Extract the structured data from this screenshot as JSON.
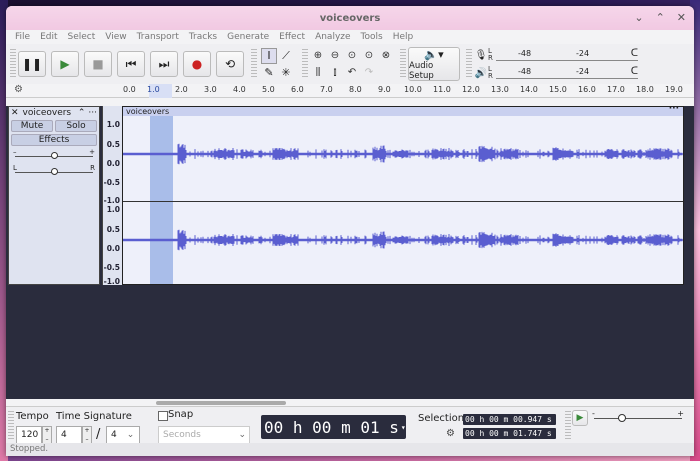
{
  "window": {
    "title": "voiceovers",
    "controls": [
      "⌄",
      "⌃",
      "✕"
    ]
  },
  "menu": [
    "File",
    "Edit",
    "Select",
    "View",
    "Transport",
    "Tracks",
    "Generate",
    "Effect",
    "Analyze",
    "Tools",
    "Help"
  ],
  "toolbar": {
    "audio_setup_label": "Audio Setup",
    "meter_ticks": [
      "-48",
      "-24"
    ]
  },
  "ruler": {
    "ticks": [
      "0.0",
      "1.0",
      "2.0",
      "3.0",
      "4.0",
      "5.0",
      "6.0",
      "7.0",
      "8.0",
      "9.0",
      "10.0",
      "11.0",
      "12.0",
      "13.0",
      "14.0",
      "15.0",
      "16.0",
      "17.0",
      "18.0",
      "19.0"
    ]
  },
  "track": {
    "name": "voiceovers",
    "mute_label": "Mute",
    "solo_label": "Solo",
    "effects_label": "Effects",
    "gain_minus": "–",
    "gain_plus": "+",
    "pan_left": "L",
    "pan_right": "R",
    "clip_name": "voiceovers",
    "scale_top": [
      "1.0",
      "0.5",
      "0.0",
      "-0.5",
      "-1.0"
    ],
    "scale_bottom": [
      "1.0",
      "0.5",
      "0.0",
      "-0.5",
      "-1.0"
    ]
  },
  "bottom": {
    "tempo_label": "Tempo",
    "tempo_value": "120",
    "time_signature_label": "Time Signature",
    "ts_numerator": "4",
    "ts_denominator": "4",
    "ts_slash": "/",
    "snap_label": "Snap",
    "snap_unit": "Seconds",
    "timer": "00 h 00 m 01 s",
    "selection_label": "Selection",
    "selection_start": "00 h 00 m 00.947 s",
    "selection_end": "00 h 00 m 01.747 s"
  },
  "status": "Stopped."
}
